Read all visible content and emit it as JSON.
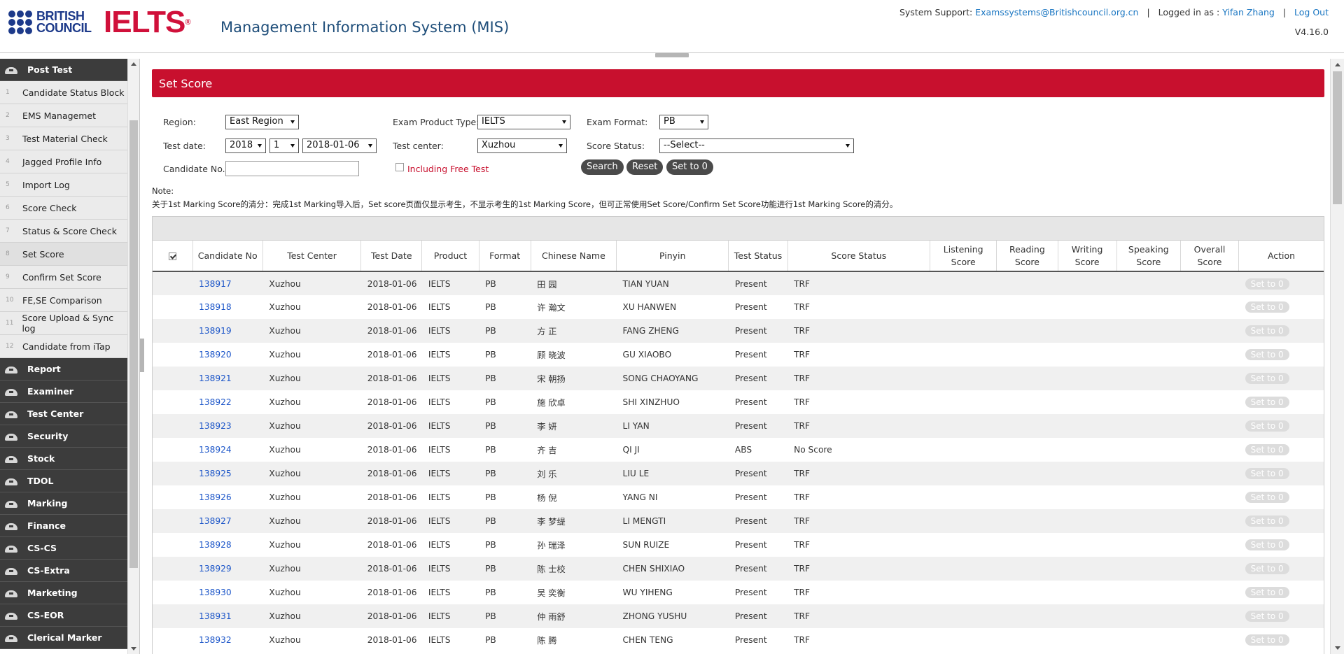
{
  "header": {
    "bc_line1": "BRITISH",
    "bc_line2": "COUNCIL",
    "ielts": "IELTS",
    "title": "Management Information System (MIS)",
    "support_label": "System Support:",
    "support_email": "Examssystems@Britishcouncil.org.cn",
    "logged_label": "Logged in as :",
    "user": "Yifan Zhang",
    "logout": "Log Out",
    "version": "V4.16.0"
  },
  "sidebar": {
    "top_section": "Post Test",
    "items": [
      {
        "num": "1",
        "label": "Candidate Status Block"
      },
      {
        "num": "2",
        "label": "EMS Managemet"
      },
      {
        "num": "3",
        "label": "Test Material Check"
      },
      {
        "num": "4",
        "label": "Jagged Profile Info"
      },
      {
        "num": "5",
        "label": "Import Log"
      },
      {
        "num": "6",
        "label": "Score Check"
      },
      {
        "num": "7",
        "label": "Status & Score Check"
      },
      {
        "num": "8",
        "label": "Set Score"
      },
      {
        "num": "9",
        "label": "Confirm Set Score"
      },
      {
        "num": "10",
        "label": "FE,SE Comparison"
      },
      {
        "num": "11",
        "label": "Score Upload & Sync log"
      },
      {
        "num": "12",
        "label": "Candidate from iTap"
      }
    ],
    "sections": [
      "Report",
      "Examiner",
      "Test Center",
      "Security",
      "Stock",
      "TDOL",
      "Marking",
      "Finance",
      "CS-CS",
      "CS-Extra",
      "Marketing",
      "CS-EOR",
      "Clerical Marker"
    ]
  },
  "page": {
    "title": "Set Score"
  },
  "filters": {
    "region_label": "Region:",
    "region_value": "East Region",
    "product_label": "Exam Product Type:",
    "product_value": "IELTS",
    "format_label": "Exam Format:",
    "format_value": "PB",
    "date_label": "Test date:",
    "year": "2018",
    "month": "1",
    "date": "2018-01-06",
    "center_label": "Test center:",
    "center_value": "Xuzhou",
    "status_label": "Score Status:",
    "status_value": "--Select--",
    "cand_label": "Candidate No.",
    "cand_value": "",
    "free_label": "Including Free Test",
    "search": "Search",
    "reset": "Reset",
    "set0": "Set to 0"
  },
  "note": {
    "label": "Note:",
    "text": "关于1st Marking Score的清分：完成1st Marking导入后，Set score页面仅显示考生，不显示考生的1st Marking Score，但可正常使用Set Score/Confirm Set Score功能进行1st Marking Score的清分。"
  },
  "table": {
    "headers": [
      "",
      "Candidate No",
      "Test Center",
      "Test Date",
      "Product",
      "Format",
      "Chinese Name",
      "Pinyin",
      "Test Status",
      "Score Status",
      "Listening Score",
      "Reading Score",
      "Writing Score",
      "Speaking Score",
      "Overall Score",
      "Action"
    ],
    "action_label": "Set to 0",
    "rows": [
      {
        "no": "138917",
        "center": "Xuzhou",
        "date": "2018-01-06",
        "product": "IELTS",
        "format": "PB",
        "cn": "田 园",
        "pinyin": "TIAN YUAN",
        "status": "Present",
        "score_status": "TRF"
      },
      {
        "no": "138918",
        "center": "Xuzhou",
        "date": "2018-01-06",
        "product": "IELTS",
        "format": "PB",
        "cn": "许 瀚文",
        "pinyin": "XU HANWEN",
        "status": "Present",
        "score_status": "TRF"
      },
      {
        "no": "138919",
        "center": "Xuzhou",
        "date": "2018-01-06",
        "product": "IELTS",
        "format": "PB",
        "cn": "方 正",
        "pinyin": "FANG ZHENG",
        "status": "Present",
        "score_status": "TRF"
      },
      {
        "no": "138920",
        "center": "Xuzhou",
        "date": "2018-01-06",
        "product": "IELTS",
        "format": "PB",
        "cn": "顾 晓波",
        "pinyin": "GU XIAOBO",
        "status": "Present",
        "score_status": "TRF"
      },
      {
        "no": "138921",
        "center": "Xuzhou",
        "date": "2018-01-06",
        "product": "IELTS",
        "format": "PB",
        "cn": "宋 朝扬",
        "pinyin": "SONG CHAOYANG",
        "status": "Present",
        "score_status": "TRF"
      },
      {
        "no": "138922",
        "center": "Xuzhou",
        "date": "2018-01-06",
        "product": "IELTS",
        "format": "PB",
        "cn": "施 欣卓",
        "pinyin": "SHI XINZHUO",
        "status": "Present",
        "score_status": "TRF"
      },
      {
        "no": "138923",
        "center": "Xuzhou",
        "date": "2018-01-06",
        "product": "IELTS",
        "format": "PB",
        "cn": "李 妍",
        "pinyin": "LI YAN",
        "status": "Present",
        "score_status": "TRF"
      },
      {
        "no": "138924",
        "center": "Xuzhou",
        "date": "2018-01-06",
        "product": "IELTS",
        "format": "PB",
        "cn": "齐 吉",
        "pinyin": "QI JI",
        "status": "ABS",
        "score_status": "No Score"
      },
      {
        "no": "138925",
        "center": "Xuzhou",
        "date": "2018-01-06",
        "product": "IELTS",
        "format": "PB",
        "cn": "刘 乐",
        "pinyin": "LIU LE",
        "status": "Present",
        "score_status": "TRF"
      },
      {
        "no": "138926",
        "center": "Xuzhou",
        "date": "2018-01-06",
        "product": "IELTS",
        "format": "PB",
        "cn": "杨 倪",
        "pinyin": "YANG NI",
        "status": "Present",
        "score_status": "TRF"
      },
      {
        "no": "138927",
        "center": "Xuzhou",
        "date": "2018-01-06",
        "product": "IELTS",
        "format": "PB",
        "cn": "李 梦缇",
        "pinyin": "LI MENGTI",
        "status": "Present",
        "score_status": "TRF"
      },
      {
        "no": "138928",
        "center": "Xuzhou",
        "date": "2018-01-06",
        "product": "IELTS",
        "format": "PB",
        "cn": "孙 瑞泽",
        "pinyin": "SUN RUIZE",
        "status": "Present",
        "score_status": "TRF"
      },
      {
        "no": "138929",
        "center": "Xuzhou",
        "date": "2018-01-06",
        "product": "IELTS",
        "format": "PB",
        "cn": "陈 士校",
        "pinyin": "CHEN SHIXIAO",
        "status": "Present",
        "score_status": "TRF"
      },
      {
        "no": "138930",
        "center": "Xuzhou",
        "date": "2018-01-06",
        "product": "IELTS",
        "format": "PB",
        "cn": "吴 奕衡",
        "pinyin": "WU YIHENG",
        "status": "Present",
        "score_status": "TRF"
      },
      {
        "no": "138931",
        "center": "Xuzhou",
        "date": "2018-01-06",
        "product": "IELTS",
        "format": "PB",
        "cn": "仲 雨舒",
        "pinyin": "ZHONG YUSHU",
        "status": "Present",
        "score_status": "TRF"
      },
      {
        "no": "138932",
        "center": "Xuzhou",
        "date": "2018-01-06",
        "product": "IELTS",
        "format": "PB",
        "cn": "陈 腾",
        "pinyin": "CHEN TENG",
        "status": "Present",
        "score_status": "TRF"
      }
    ]
  }
}
